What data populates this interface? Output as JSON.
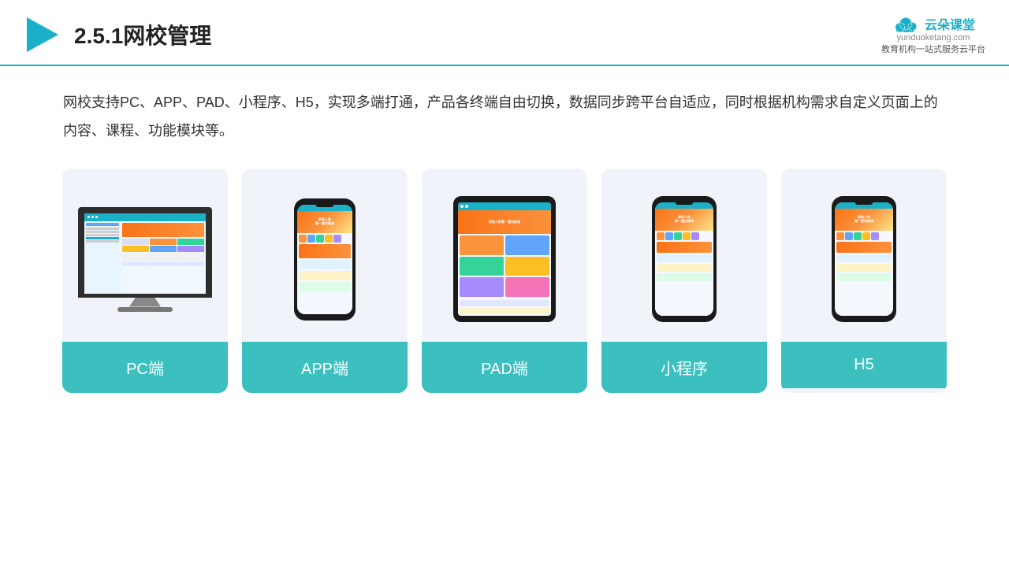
{
  "header": {
    "title": "2.5.1网校管理",
    "logo": {
      "name": "云朵课堂",
      "url": "yunduoketang.com",
      "tagline": "教育机构一站式服务云平台"
    }
  },
  "description": {
    "text": "网校支持PC、APP、PAD、小程序、H5，实现多端打通，产品各终端自由切换，数据同步跨平台自适应，同时根据机构需求自定义页面上的内容、课程、功能模块等。"
  },
  "cards": [
    {
      "id": "pc",
      "label": "PC端"
    },
    {
      "id": "app",
      "label": "APP端"
    },
    {
      "id": "pad",
      "label": "PAD端"
    },
    {
      "id": "miniprogram",
      "label": "小程序"
    },
    {
      "id": "h5",
      "label": "H5"
    }
  ]
}
